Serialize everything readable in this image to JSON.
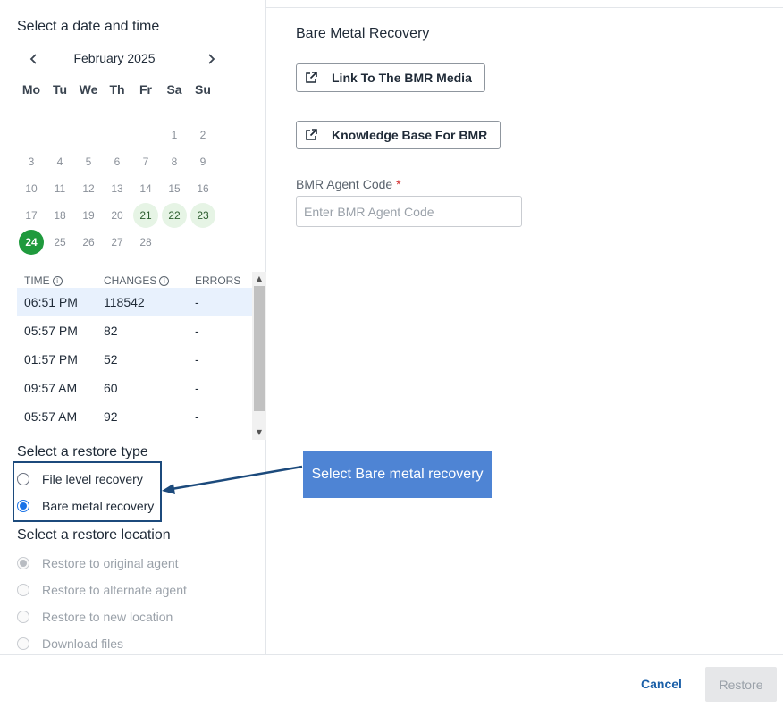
{
  "date_section": {
    "title": "Select a date and time",
    "month_label": "February 2025",
    "weekdays": [
      "Mo",
      "Tu",
      "We",
      "Th",
      "Fr",
      "Sa",
      "Su"
    ],
    "days": [
      "1",
      "2",
      "3",
      "4",
      "5",
      "6",
      "7",
      "8",
      "9",
      "10",
      "11",
      "12",
      "13",
      "14",
      "15",
      "16",
      "17",
      "18",
      "19",
      "20",
      "21",
      "22",
      "23",
      "24",
      "25",
      "26",
      "27",
      "28"
    ],
    "available_days": [
      "21",
      "22",
      "23"
    ],
    "selected_day": "24"
  },
  "snapshots": {
    "headers": {
      "time": "TIME",
      "changes": "CHANGES",
      "errors": "ERRORS"
    },
    "rows": [
      {
        "time": "06:51 PM",
        "changes": "118542",
        "errors": "-"
      },
      {
        "time": "05:57 PM",
        "changes": "82",
        "errors": "-"
      },
      {
        "time": "01:57 PM",
        "changes": "52",
        "errors": "-"
      },
      {
        "time": "09:57 AM",
        "changes": "60",
        "errors": "-"
      },
      {
        "time": "05:57 AM",
        "changes": "92",
        "errors": "-"
      }
    ]
  },
  "restore_type": {
    "title": "Select a restore type",
    "options": [
      "File level recovery",
      "Bare metal recovery"
    ],
    "selected": "Bare metal recovery"
  },
  "restore_location": {
    "title": "Select a restore location",
    "options": [
      "Restore to original agent",
      "Restore to alternate agent",
      "Restore to new location",
      "Download files"
    ],
    "selected": "Restore to original agent"
  },
  "callout": {
    "text": "Select Bare metal recovery"
  },
  "bmr_panel": {
    "title": "Bare Metal Recovery",
    "media_link_label": "Link To The BMR Media",
    "kb_link_label": "Knowledge Base For BMR",
    "agent_code_label": "BMR Agent Code",
    "required_mark": "*",
    "agent_code_placeholder": "Enter BMR Agent Code",
    "agent_code_value": ""
  },
  "footer": {
    "cancel_label": "Cancel",
    "restore_label": "Restore"
  },
  "colors": {
    "accent": "#1a73e8",
    "selected_day": "#1f9a3d",
    "available_day": "#e6f4e5",
    "callout": "#4e84d4",
    "highlight_border": "#1c4a7c"
  }
}
